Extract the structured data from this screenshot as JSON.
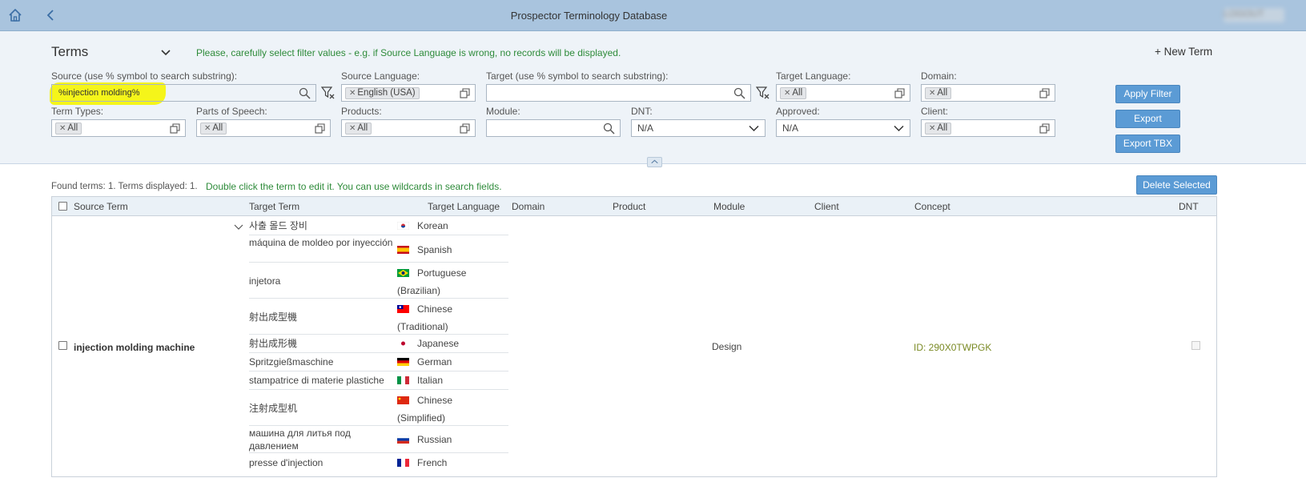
{
  "header": {
    "title": "Prospector Terminology Database",
    "user": "LOGOUT"
  },
  "panel": {
    "section_title": "Terms",
    "warning": "Please, carefully select filter values - e.g. if Source Language is wrong, no records will be displayed.",
    "new_term": "+ New Term",
    "labels": {
      "source": "Source (use % symbol to search substring):",
      "source_language": "Source Language:",
      "target": "Target (use % symbol to search substring):",
      "target_language": "Target Language:",
      "domain": "Domain:",
      "term_types": "Term Types:",
      "parts_of_speech": "Parts of Speech:",
      "products": "Products:",
      "module": "Module:",
      "dnt": "DNT:",
      "approved": "Approved:",
      "client": "Client:"
    },
    "values": {
      "source": "%injection molding%",
      "source_language": "English (USA)",
      "target": "",
      "target_language": "All",
      "domain": "All",
      "term_types": "All",
      "parts_of_speech": "All",
      "products": "All",
      "module": "",
      "dnt": "N/A",
      "approved": "N/A",
      "client": "All"
    },
    "buttons": {
      "apply": "Apply Filter",
      "export": "Export",
      "export_tbx": "Export TBX"
    }
  },
  "results": {
    "found": "Found terms: 1. Terms displayed: 1.",
    "hint": "Double click the term to edit it. You can use wildcards in search fields.",
    "delete": "Delete Selected",
    "columns": [
      "Source Term",
      "Target Term",
      "Target Language",
      "Domain",
      "Product",
      "Module",
      "Client",
      "Concept",
      "DNT"
    ],
    "row": {
      "source_term": "injection molding machine",
      "module": "Design",
      "concept": "ID: 290X0TWPGK",
      "targets": [
        {
          "term": "사출 몰드 장비",
          "lang": "Korean",
          "flag": "korea-flag-icon"
        },
        {
          "term": "máquina de moldeo por inyección",
          "lang": "Spanish",
          "flag": "spain-flag-icon"
        },
        {
          "term": "injetora",
          "lang": "Portuguese",
          "lang2": "(Brazilian)",
          "flag": "brazil-flag-icon"
        },
        {
          "term": "射出成型機",
          "lang": "Chinese",
          "lang2": "(Traditional)",
          "flag": "taiwan-flag-icon"
        },
        {
          "term": "射出成形機",
          "lang": "Japanese",
          "flag": "japan-flag-icon"
        },
        {
          "term": "Spritzgießmaschine",
          "lang": "German",
          "flag": "germany-flag-icon"
        },
        {
          "term": "stampatrice di materie plastiche",
          "lang": "Italian",
          "flag": "italy-flag-icon"
        },
        {
          "term": "注射成型机",
          "lang": "Chinese",
          "lang2": "(Simplified)",
          "flag": "china-flag-icon"
        },
        {
          "term": "машина для литья под давлением",
          "lang": "Russian",
          "flag": "russia-flag-icon"
        },
        {
          "term": "presse d'injection",
          "lang": "French",
          "flag": "france-flag-icon"
        }
      ]
    }
  }
}
